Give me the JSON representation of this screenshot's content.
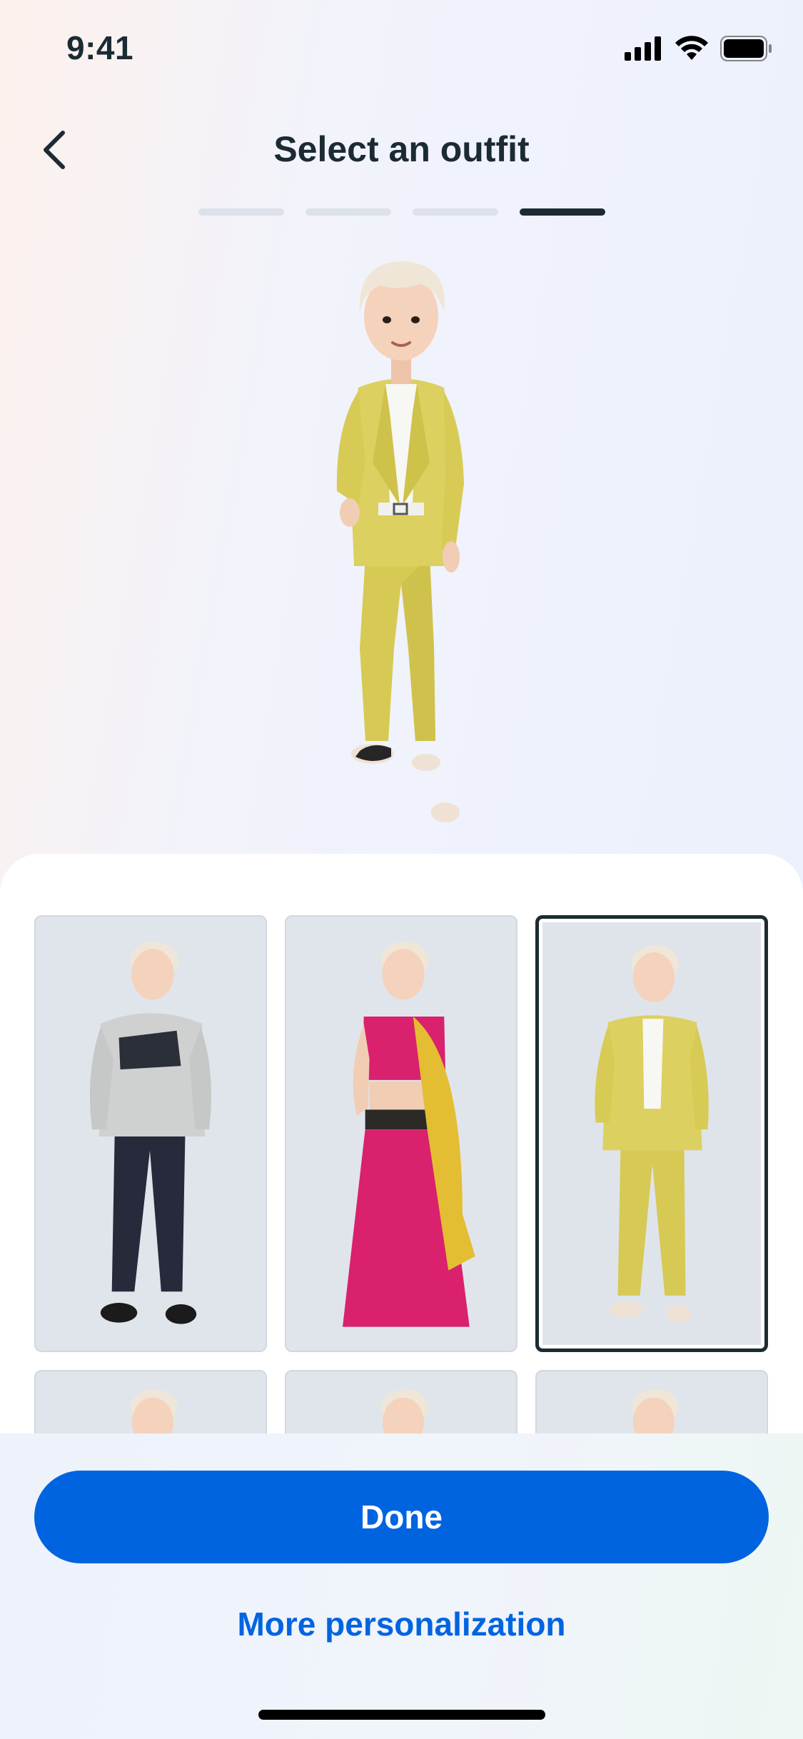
{
  "status_bar": {
    "time": "9:41",
    "icons": [
      "signal-icon",
      "wifi-icon",
      "battery-icon"
    ]
  },
  "header": {
    "title": "Select an outfit",
    "back_icon": "chevron-left-icon",
    "progress": {
      "steps": 4,
      "current": 4
    }
  },
  "preview": {
    "outfit": "yellow suit with white shirt",
    "colors": {
      "skin": "#f1cdb4",
      "hair": "#efe6d8",
      "suit": "#dcd060",
      "shirt": "#f7f7f4",
      "shoes": "#f0e3d6"
    }
  },
  "outfits": [
    {
      "name": "grey hoodie and dark jeans",
      "selected": false,
      "colors": {
        "top": "#cfd1d1",
        "bottom": "#262a3a",
        "shoes": "#1b1b1b"
      }
    },
    {
      "name": "pink lehenga with dupatta",
      "selected": false,
      "colors": {
        "top": "#d9216e",
        "bottom": "#d9216e",
        "accent": "#e3be33"
      }
    },
    {
      "name": "yellow suit",
      "selected": true,
      "colors": {
        "top": "#dcd060",
        "bottom": "#dcd060",
        "shirt": "#f7f7f4"
      }
    },
    {
      "name": "",
      "selected": false
    },
    {
      "name": "",
      "selected": false
    },
    {
      "name": "",
      "selected": false
    }
  ],
  "footer": {
    "done_label": "Done",
    "more_label": "More personalization"
  },
  "theme": {
    "accent": "#0064e0",
    "text": "#1c2b33"
  }
}
